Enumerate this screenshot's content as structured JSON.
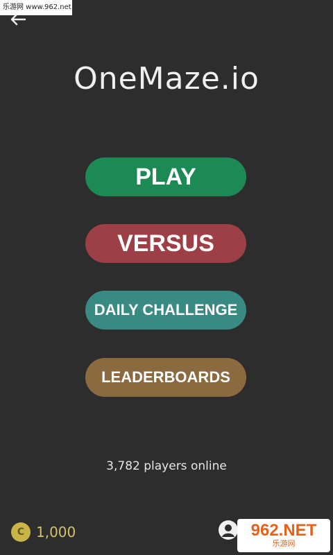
{
  "watermark": {
    "top_text": "乐游网 www.962.net",
    "bottom_logo": "962.NET",
    "bottom_sub": "乐游网"
  },
  "header": {
    "back_icon": "arrow-left-icon"
  },
  "game": {
    "title": "OneMaze.io"
  },
  "menu": {
    "play_label": "PLAY",
    "versus_label": "VERSUS",
    "daily_label": "DAILY CHALLENGE",
    "leaderboards_label": "LEADERBOARDS"
  },
  "status": {
    "players_online": "3,782 players online"
  },
  "footer": {
    "coin_symbol": "C",
    "coins": "1,000",
    "profile_icon": "user-icon"
  },
  "colors": {
    "background": "#2d2d2d",
    "play": "#1d8a56",
    "versus": "#9c3f47",
    "daily": "#3a8a84",
    "leaderboards": "#8c6a40",
    "coin": "#c9b44a"
  }
}
